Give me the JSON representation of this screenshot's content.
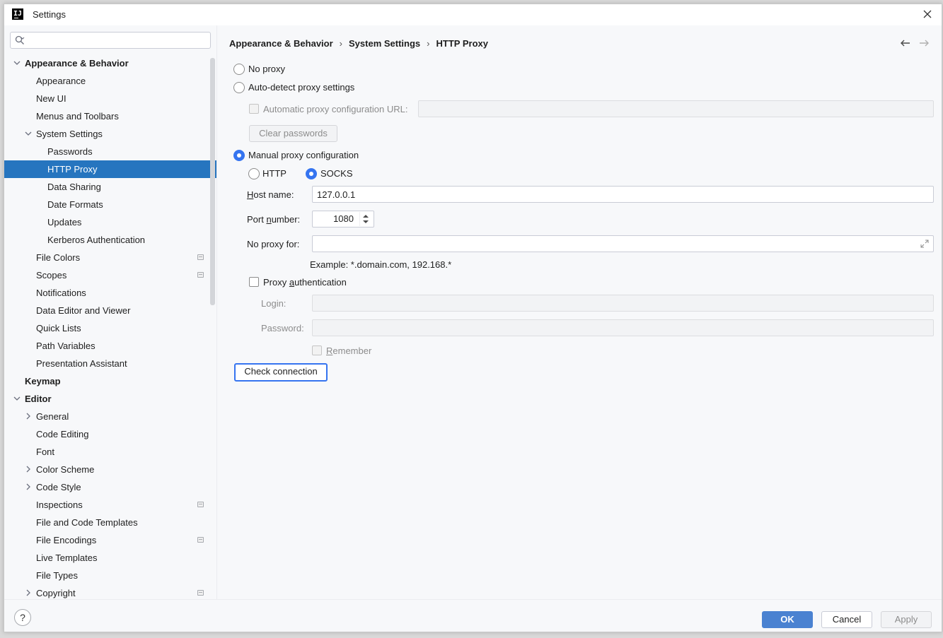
{
  "window": {
    "title": "Settings",
    "logo_text": "IJ"
  },
  "sidebar": {
    "search": {
      "value": "",
      "placeholder": ""
    },
    "items": [
      {
        "label": "Appearance & Behavior",
        "level": 0,
        "expander": "expanded",
        "bold": true
      },
      {
        "label": "Appearance",
        "level": 1
      },
      {
        "label": "New UI",
        "level": 1
      },
      {
        "label": "Menus and Toolbars",
        "level": 1
      },
      {
        "label": "System Settings",
        "level": 1,
        "expander": "expanded"
      },
      {
        "label": "Passwords",
        "level": 2
      },
      {
        "label": "HTTP Proxy",
        "level": 2,
        "selected": true
      },
      {
        "label": "Data Sharing",
        "level": 2
      },
      {
        "label": "Date Formats",
        "level": 2
      },
      {
        "label": "Updates",
        "level": 2
      },
      {
        "label": "Kerberos Authentication",
        "level": 2
      },
      {
        "label": "File Colors",
        "level": 1,
        "badge": true
      },
      {
        "label": "Scopes",
        "level": 1,
        "badge": true
      },
      {
        "label": "Notifications",
        "level": 1
      },
      {
        "label": "Data Editor and Viewer",
        "level": 1
      },
      {
        "label": "Quick Lists",
        "level": 1
      },
      {
        "label": "Path Variables",
        "level": 1
      },
      {
        "label": "Presentation Assistant",
        "level": 1
      },
      {
        "label": "Keymap",
        "level": 0,
        "bold": true
      },
      {
        "label": "Editor",
        "level": 0,
        "expander": "expanded",
        "bold": true
      },
      {
        "label": "General",
        "level": 1,
        "expander": "collapsed"
      },
      {
        "label": "Code Editing",
        "level": 1
      },
      {
        "label": "Font",
        "level": 1
      },
      {
        "label": "Color Scheme",
        "level": 1,
        "expander": "collapsed"
      },
      {
        "label": "Code Style",
        "level": 1,
        "expander": "collapsed"
      },
      {
        "label": "Inspections",
        "level": 1,
        "badge": true
      },
      {
        "label": "File and Code Templates",
        "level": 1
      },
      {
        "label": "File Encodings",
        "level": 1,
        "badge": true
      },
      {
        "label": "Live Templates",
        "level": 1
      },
      {
        "label": "File Types",
        "level": 1
      },
      {
        "label": "Copyright",
        "level": 1,
        "expander": "collapsed",
        "badge": true
      }
    ]
  },
  "breadcrumb": [
    "Appearance & Behavior",
    "System Settings",
    "HTTP Proxy"
  ],
  "breadcrumb_separator": "›",
  "proxy": {
    "no_proxy_label": "No proxy",
    "auto_detect_label": "Auto-detect proxy settings",
    "auto_config_url_label": "Automatic proxy configuration URL:",
    "auto_config_url_value": "",
    "clear_passwords_label": "Clear passwords",
    "manual_label": "Manual proxy configuration",
    "http_label": "HTTP",
    "socks_label": "SOCKS",
    "host_label_mnemonic": "H",
    "host_label_rest": "ost name:",
    "host_value": "127.0.0.1",
    "port_label_pre": "Port ",
    "port_label_mnemonic": "n",
    "port_label_rest": "umber:",
    "port_value": "1080",
    "no_proxy_for_label": "No proxy for:",
    "no_proxy_for_value": "",
    "example_text": "Example: *.domain.com, 192.168.*",
    "auth_label_pre": "Proxy ",
    "auth_label_mnemonic": "a",
    "auth_label_rest": "uthentication",
    "login_label": "Login:",
    "login_value": "",
    "password_label": "Password:",
    "password_value": "",
    "remember_label_mnemonic": "R",
    "remember_label_rest": "emember",
    "check_connection_label": "Check connection"
  },
  "footer": {
    "help_label": "?",
    "ok_label": "OK",
    "cancel_label": "Cancel",
    "apply_label": "Apply"
  },
  "colors": {
    "selection": "#2675bf",
    "accent": "#3574f0"
  }
}
